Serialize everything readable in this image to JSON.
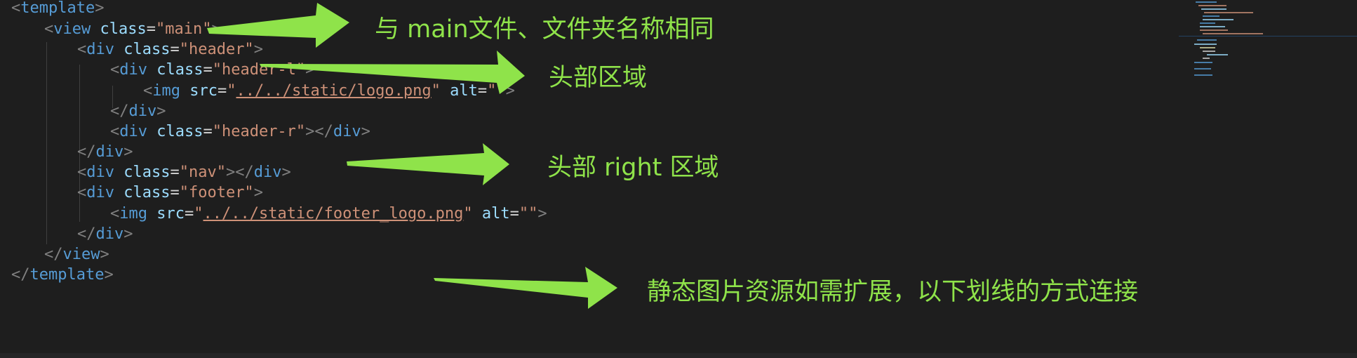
{
  "code": {
    "lines": [
      [
        [
          "punc",
          "<"
        ],
        [
          "tag",
          "template"
        ],
        [
          "punc",
          ">"
        ]
      ],
      [
        [
          "punc",
          "<"
        ],
        [
          "tag",
          "view "
        ],
        [
          "attr",
          "class"
        ],
        [
          "eq",
          "="
        ],
        [
          "str",
          "\"main\""
        ],
        [
          "punc",
          ">"
        ]
      ],
      [
        [
          "punc",
          "<"
        ],
        [
          "tag",
          "div "
        ],
        [
          "attr",
          "class"
        ],
        [
          "eq",
          "="
        ],
        [
          "str",
          "\"header\""
        ],
        [
          "punc",
          ">"
        ]
      ],
      [
        [
          "punc",
          "<"
        ],
        [
          "tag",
          "div "
        ],
        [
          "attr",
          "class"
        ],
        [
          "eq",
          "="
        ],
        [
          "str",
          "\"header-l\""
        ],
        [
          "punc",
          ">"
        ]
      ],
      [
        [
          "punc",
          "<"
        ],
        [
          "tag",
          "img "
        ],
        [
          "attr",
          "src"
        ],
        [
          "eq",
          "="
        ],
        [
          "str",
          "\""
        ],
        [
          "link",
          "../../static/logo.png"
        ],
        [
          "str",
          "\""
        ],
        [
          "attr",
          " alt"
        ],
        [
          "eq",
          "="
        ],
        [
          "str",
          "\"\""
        ],
        [
          "punc",
          ">"
        ]
      ],
      [
        [
          "punc",
          "</"
        ],
        [
          "tag",
          "div"
        ],
        [
          "punc",
          ">"
        ]
      ],
      [
        [
          "punc",
          "<"
        ],
        [
          "tag",
          "div "
        ],
        [
          "attr",
          "class"
        ],
        [
          "eq",
          "="
        ],
        [
          "str",
          "\"header-r\""
        ],
        [
          "punc",
          "></"
        ],
        [
          "tag",
          "div"
        ],
        [
          "punc",
          ">"
        ]
      ],
      [
        [
          "punc",
          "</"
        ],
        [
          "tag",
          "div"
        ],
        [
          "punc",
          ">"
        ]
      ],
      [
        [
          "punc",
          "<"
        ],
        [
          "tag",
          "div "
        ],
        [
          "attr",
          "class"
        ],
        [
          "eq",
          "="
        ],
        [
          "str",
          "\"nav\""
        ],
        [
          "punc",
          "></"
        ],
        [
          "tag",
          "div"
        ],
        [
          "punc",
          ">"
        ]
      ],
      [
        [
          "punc",
          "<"
        ],
        [
          "tag",
          "div "
        ],
        [
          "attr",
          "class"
        ],
        [
          "eq",
          "="
        ],
        [
          "str",
          "\"footer\""
        ],
        [
          "punc",
          ">"
        ]
      ],
      [
        [
          "punc",
          "<"
        ],
        [
          "tag",
          "img "
        ],
        [
          "attr",
          "src"
        ],
        [
          "eq",
          "="
        ],
        [
          "str",
          "\""
        ],
        [
          "link",
          "../../static/footer_logo.png"
        ],
        [
          "str",
          "\""
        ],
        [
          "attr",
          " alt"
        ],
        [
          "eq",
          "="
        ],
        [
          "str",
          "\"\""
        ],
        [
          "punc",
          ">"
        ]
      ],
      [
        [
          "punc",
          "</"
        ],
        [
          "tag",
          "div"
        ],
        [
          "punc",
          ">"
        ]
      ],
      [
        [
          "punc",
          "</"
        ],
        [
          "tag",
          "view"
        ],
        [
          "punc",
          ">"
        ]
      ],
      [
        [
          "punc",
          "</"
        ],
        [
          "tag",
          "template"
        ],
        [
          "punc",
          ">"
        ]
      ]
    ]
  },
  "annotations": {
    "main": "与 main文件、文件夹名称相同",
    "header": "头部区域",
    "header_right": "头部 right 区域",
    "static": "静态图片资源如需扩展，以下划线的方式连接"
  },
  "colors": {
    "background": "#1e1e1e",
    "tag": "#569cd6",
    "attribute": "#9cdcfe",
    "string": "#ce9178",
    "punctuation": "#808080",
    "annotation": "#8fe34a"
  },
  "icons": {
    "arrow": "right-pointing-arrow-icon"
  }
}
